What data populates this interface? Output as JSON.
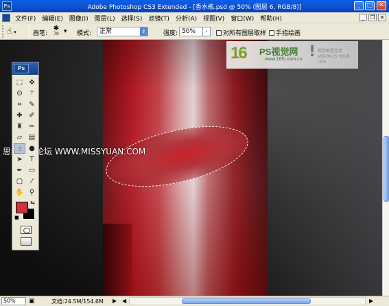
{
  "window": {
    "title": "Adobe Photoshop CS3 Extended - [香水瓶.psd @ 50% (图层 6, RGB/8)]",
    "app_icon_label": "Ps",
    "controls": {
      "minimize": "_",
      "maximize": "□",
      "close": "✕"
    }
  },
  "menubar": {
    "items": [
      "文件(F)",
      "编辑(E)",
      "图像(I)",
      "图层(L)",
      "选择(S)",
      "滤镜(T)",
      "分析(A)",
      "视图(V)",
      "窗口(W)",
      "帮助(H)"
    ],
    "doc_controls": {
      "minimize": "_",
      "restore": "❐",
      "close": "✕"
    }
  },
  "options_bar": {
    "tool_icon": "finger-smudge-icon",
    "brush_label": "画笔:",
    "brush_size": "70",
    "mode_label": "模式:",
    "mode_value": "正常",
    "strength_label": "强度:",
    "strength_value": "50%",
    "sample_all_layers": "对所有图层取样",
    "finger_painting": "手指绘画"
  },
  "toolbox": {
    "header_label": "Ps",
    "tools": [
      "marquee-icon",
      "move-icon",
      "lasso-icon",
      "magic-wand-icon",
      "crop-icon",
      "slice-icon",
      "healing-brush-icon",
      "brush-icon",
      "clone-stamp-icon",
      "history-brush-icon",
      "eraser-icon",
      "gradient-icon",
      "smudge-icon",
      "dodge-icon",
      "path-selection-icon",
      "type-icon",
      "pen-icon",
      "shape-icon",
      "notes-icon",
      "eyedropper-icon",
      "hand-icon",
      "zoom-icon"
    ],
    "selected_tool": "smudge-icon",
    "foreground_color": "#c8353a",
    "background_color": "#000000"
  },
  "canvas": {
    "watermark": "思缘设计论坛 WWW.MISSYUAN.COM",
    "logo": {
      "mark": "16",
      "name": "PS视觉网",
      "url": "www.16fs.com.cn",
      "bang": "!",
      "slogan": "视觉即是生活 VISION IS YOUR LIFE"
    }
  },
  "statusbar": {
    "zoom": "50%",
    "doc_info": "文档:24.5M/154.6M",
    "arrow_right": "▶",
    "arrow_left": "◀"
  }
}
